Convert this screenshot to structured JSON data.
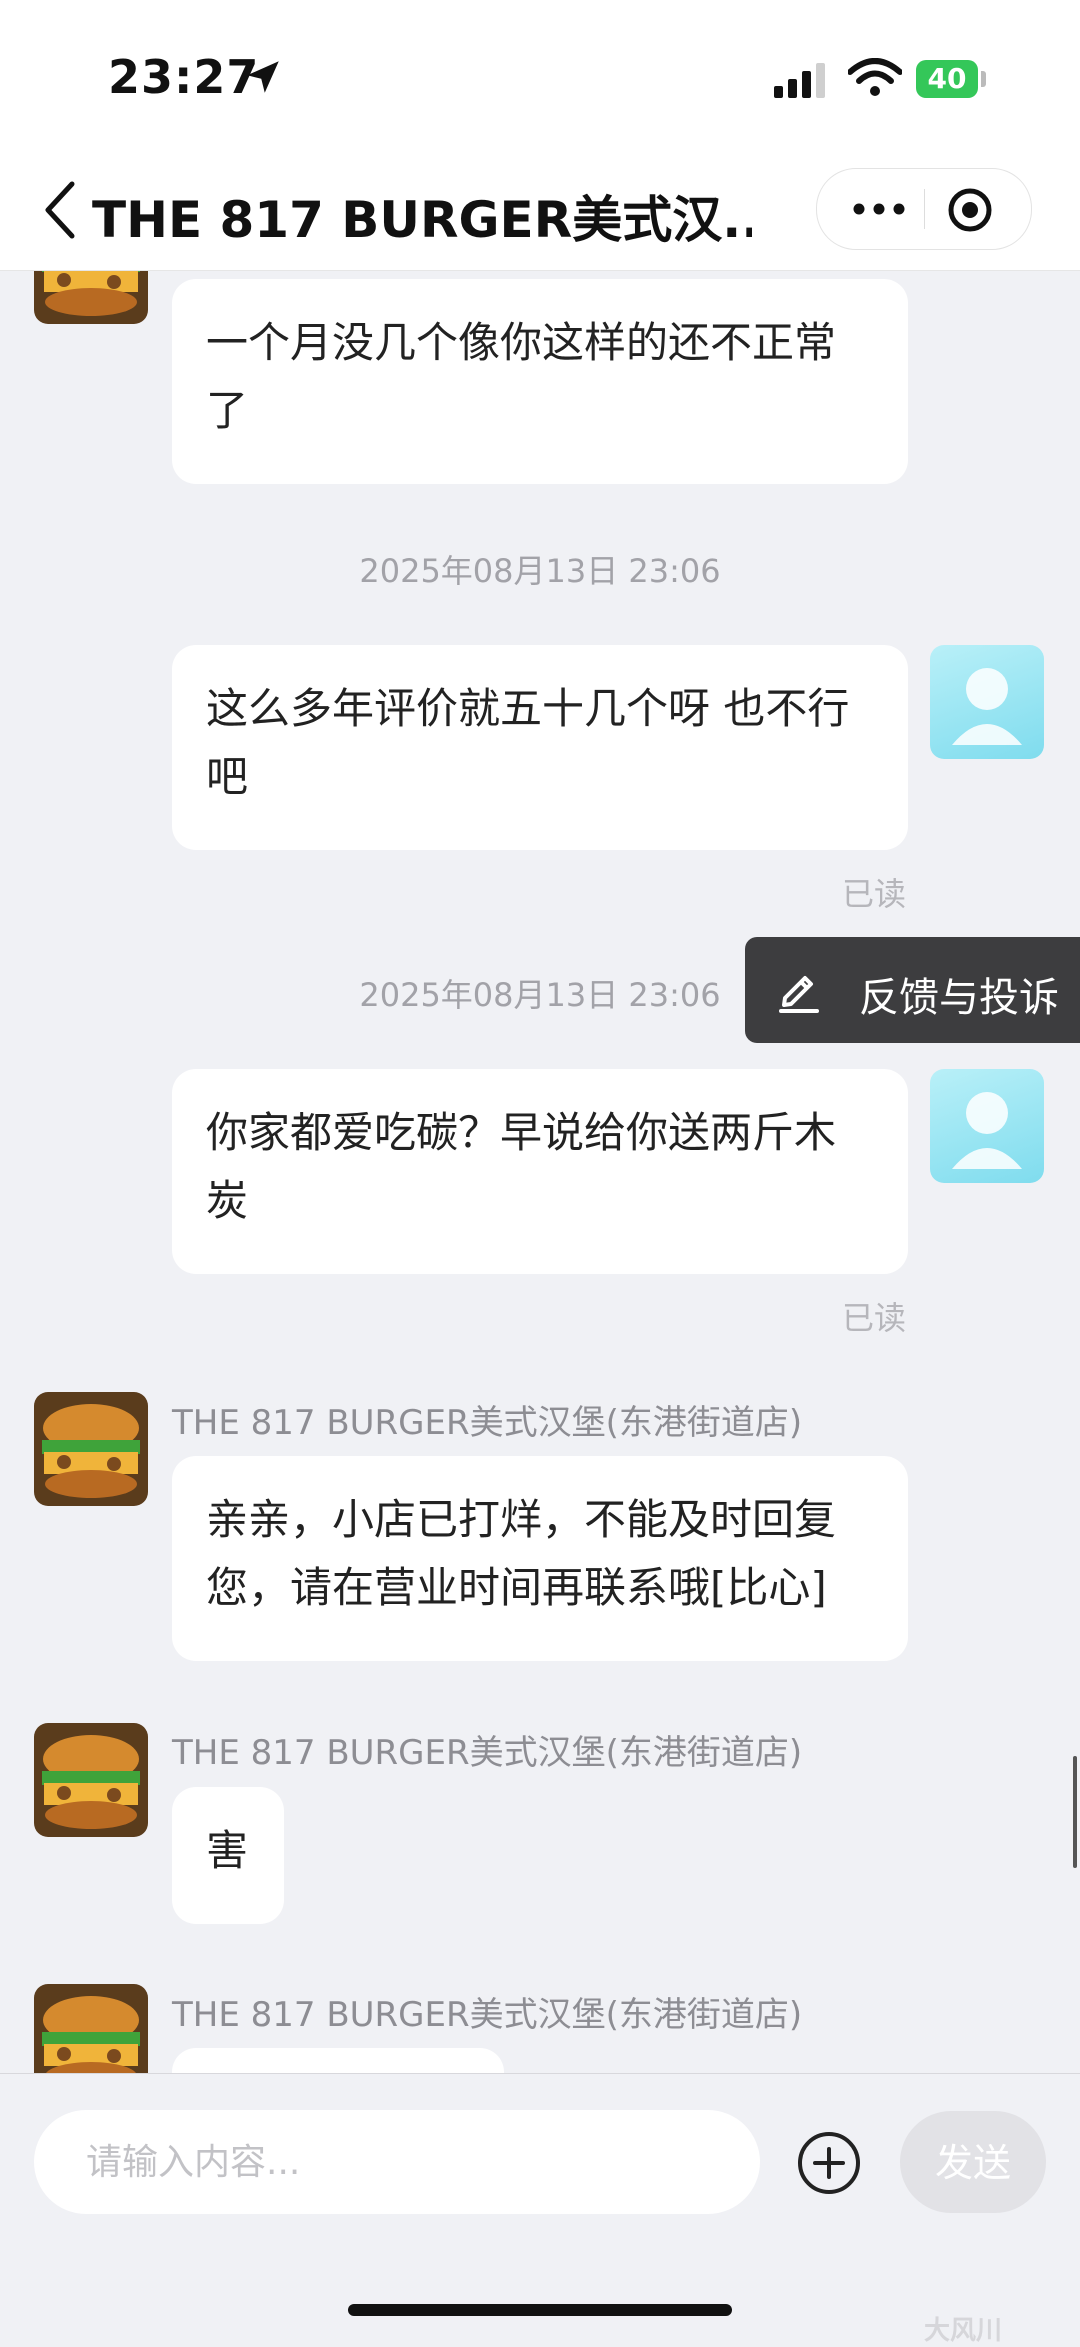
{
  "status_bar": {
    "time": "23:27",
    "battery": "40"
  },
  "nav": {
    "title": "THE 817 BURGER美式汉..."
  },
  "messages": [
    {
      "side": "shop",
      "text": "一个月没几个像你这样的还不正常了"
    },
    {
      "type": "time",
      "text": "2025年08月13日 23:06"
    },
    {
      "side": "user",
      "text": "这么多年评价就五十几个呀 也不行吧",
      "status": "已读"
    },
    {
      "type": "time",
      "text": "2025年08月13日 23:06"
    },
    {
      "side": "user",
      "text": "你家都爱吃碳？早说给你送两斤木炭",
      "status": "已读"
    },
    {
      "side": "shop",
      "sender": "THE 817 BURGER美式汉堡(东港街道店)",
      "text": "亲亲，小店已打烊，不能及时回复您，请在营业时间再联系哦[比心]"
    },
    {
      "side": "shop",
      "sender": "THE 817 BURGER美式汉堡(东港街道店)",
      "text": "害"
    },
    {
      "side": "shop",
      "sender": "THE 817 BURGER美式汉堡(东港街道店)",
      "text": ""
    }
  ],
  "feedback": {
    "label": "反馈与投诉"
  },
  "input": {
    "placeholder": "请输入内容...",
    "send_label": "发送"
  },
  "watermark": "大风川",
  "icons": [
    "location-arrow-icon",
    "signal-icon",
    "wifi-icon",
    "back-chevron-icon",
    "more-dots-icon",
    "target-icon",
    "pen-icon",
    "plus-circle-icon"
  ]
}
